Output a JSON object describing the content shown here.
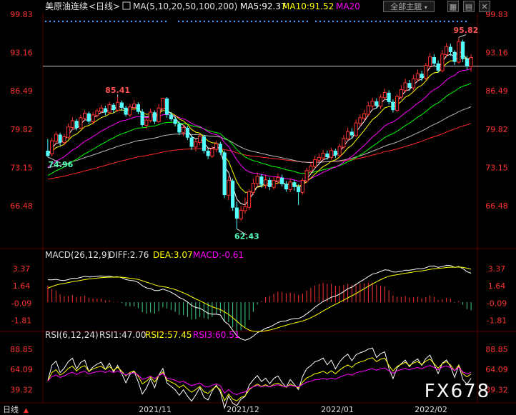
{
  "colors": {
    "up": "#ff3232",
    "down": "#54ffff",
    "ma5": "#ffffff",
    "ma10": "#ffff00",
    "ma20": "#ff00ff",
    "ma50": "#00ff00",
    "ma100": "#bbbbbb",
    "ma200": "#ff2a2a",
    "axis": "#ff3232",
    "grid": "#5a0000",
    "high_label": "#ff5050",
    "low_label": "#54ffbb"
  },
  "header": {
    "instrument": "美原油连续",
    "period": "<日线>",
    "ma_set": "MA(5,10,20,50,100,200)",
    "ma5": "MA5:92.37",
    "ma10": "MA10:91.52",
    "ma20": "MA20",
    "dropdown_value": "全部主题",
    "icon_names": [
      "chart-icon",
      "grid-icon",
      "close-icon"
    ]
  },
  "price_panel": {
    "y_ticks": [
      "99.83",
      "93.16",
      "86.49",
      "79.82",
      "73.15",
      "66.48"
    ],
    "annotations": {
      "high_1": "85.41",
      "low_1": "74.96",
      "low_2": "62.43",
      "high_2": "95.82"
    }
  },
  "macd_panel": {
    "title": "MACD(26,12,9)",
    "diff": "DIFF:2.76",
    "dea": "DEA:3.07",
    "macd": "MACD:-0.61",
    "y_ticks": [
      "3.37",
      "1.64",
      "-0.09",
      "-1.81"
    ]
  },
  "rsi_panel": {
    "title": "RSI(6,12,24)",
    "rsi1": "RSI1:47.00",
    "rsi2": "RSI2:57.45",
    "rsi3": "RSI3:60.51",
    "y_ticks": [
      "88.85",
      "64.09",
      "39.32"
    ]
  },
  "bottom": {
    "period_tab": "日线",
    "dates": [
      "2021/11",
      "2021/12",
      "2022/01",
      "2022/02"
    ]
  },
  "watermark": "FX678",
  "chart_data": {
    "type": "candlestick",
    "ylim": [
      62.0,
      99.83
    ],
    "candles": [
      [
        76,
        75.2,
        78.1,
        74.96
      ],
      [
        75.5,
        77.8,
        78.3,
        75.1
      ],
      [
        77.7,
        78.9,
        79.4,
        77.2
      ],
      [
        78.8,
        77.6,
        79.2,
        76.9
      ],
      [
        77.5,
        78.5,
        79.0,
        77.0
      ],
      [
        78.4,
        80.2,
        80.8,
        78.1
      ],
      [
        80.1,
        81.3,
        81.9,
        79.7
      ],
      [
        81.2,
        80.1,
        81.6,
        79.6
      ],
      [
        80.0,
        81.8,
        82.3,
        79.8
      ],
      [
        81.7,
        82.6,
        83.1,
        81.3
      ],
      [
        82.5,
        81.2,
        82.9,
        80.7
      ],
      [
        81.1,
        82.3,
        82.8,
        80.6
      ],
      [
        82.2,
        83.0,
        83.4,
        81.8
      ],
      [
        82.9,
        83.5,
        84.1,
        82.5
      ],
      [
        83.4,
        82.8,
        83.9,
        82.2
      ],
      [
        82.7,
        84.1,
        84.6,
        82.4
      ],
      [
        84.0,
        83.2,
        84.4,
        82.6
      ],
      [
        83.1,
        84.5,
        85.41,
        82.9
      ],
      [
        84.4,
        83.6,
        84.8,
        83.0
      ],
      [
        83.5,
        82.4,
        83.9,
        82.0
      ],
      [
        82.3,
        83.7,
        84.2,
        81.9
      ],
      [
        83.6,
        84.2,
        84.9,
        83.1
      ],
      [
        84.1,
        82.9,
        84.5,
        82.4
      ],
      [
        82.8,
        80.6,
        83.3,
        80.2
      ],
      [
        80.5,
        81.4,
        81.9,
        79.9
      ],
      [
        81.3,
        82.8,
        83.4,
        81.0
      ],
      [
        82.7,
        81.2,
        83.1,
        80.7
      ],
      [
        81.1,
        83.5,
        84.2,
        80.9
      ],
      [
        83.4,
        85.2,
        85.3,
        83.0
      ],
      [
        85.1,
        82.4,
        85.4,
        81.8
      ],
      [
        82.3,
        81.6,
        82.8,
        81.2
      ],
      [
        81.5,
        80.8,
        82.0,
        80.3
      ],
      [
        80.7,
        79.3,
        81.2,
        78.8
      ],
      [
        79.2,
        80.1,
        80.6,
        78.6
      ],
      [
        80.0,
        78.4,
        80.4,
        77.9
      ],
      [
        78.3,
        76.8,
        78.8,
        76.2
      ],
      [
        76.7,
        77.6,
        78.1,
        75.9
      ],
      [
        77.5,
        78.6,
        79.1,
        77.0
      ],
      [
        78.5,
        76.1,
        78.8,
        75.6
      ],
      [
        76.0,
        75.2,
        76.5,
        74.6
      ],
      [
        75.1,
        76.4,
        76.9,
        74.8
      ],
      [
        76.3,
        77.3,
        77.8,
        75.8
      ],
      [
        77.2,
        75.8,
        77.6,
        75.3
      ],
      [
        75.7,
        68.4,
        76.1,
        67.8
      ],
      [
        68.3,
        70.9,
        71.6,
        67.4
      ],
      [
        70.8,
        66.2,
        71.2,
        65.6
      ],
      [
        66.1,
        64.3,
        67.2,
        62.43
      ],
      [
        64.2,
        65.7,
        66.4,
        63.8
      ],
      [
        65.6,
        66.3,
        67.9,
        65.1
      ],
      [
        66.2,
        68.9,
        69.3,
        65.8
      ],
      [
        68.8,
        70.4,
        71.2,
        68.3
      ],
      [
        70.3,
        71.6,
        72.3,
        69.8
      ],
      [
        71.5,
        70.2,
        72.0,
        69.6
      ],
      [
        70.1,
        71.0,
        71.8,
        69.5
      ],
      [
        70.9,
        69.8,
        71.4,
        69.2
      ],
      [
        69.7,
        70.9,
        71.5,
        69.3
      ],
      [
        70.8,
        71.4,
        72.1,
        70.2
      ],
      [
        71.3,
        70.3,
        71.9,
        69.8
      ],
      [
        70.2,
        69.4,
        70.8,
        68.9
      ],
      [
        69.3,
        70.6,
        71.2,
        68.8
      ],
      [
        70.5,
        69.8,
        71.0,
        69.1
      ],
      [
        69.7,
        68.9,
        70.2,
        66.6
      ],
      [
        68.8,
        70.9,
        71.3,
        68.4
      ],
      [
        70.8,
        72.6,
        73.1,
        70.4
      ],
      [
        72.5,
        73.4,
        74.0,
        72.0
      ],
      [
        73.3,
        74.5,
        75.2,
        73.0
      ],
      [
        74.4,
        74.9,
        75.6,
        74.0
      ],
      [
        74.8,
        75.6,
        76.2,
        74.3
      ],
      [
        75.5,
        75.0,
        76.1,
        74.5
      ],
      [
        74.9,
        76.1,
        76.6,
        74.5
      ],
      [
        76.0,
        75.3,
        76.4,
        74.8
      ],
      [
        75.2,
        76.8,
        77.3,
        74.9
      ],
      [
        76.7,
        78.2,
        78.8,
        76.4
      ],
      [
        78.1,
        79.4,
        80.1,
        77.8
      ],
      [
        79.3,
        78.8,
        80.0,
        78.2
      ],
      [
        78.7,
        80.9,
        81.5,
        78.4
      ],
      [
        80.8,
        81.8,
        82.4,
        80.3
      ],
      [
        81.7,
        82.5,
        83.2,
        81.2
      ],
      [
        82.4,
        83.9,
        84.6,
        82.0
      ],
      [
        83.8,
        84.7,
        85.3,
        83.2
      ],
      [
        84.6,
        83.9,
        85.2,
        83.4
      ],
      [
        83.8,
        85.4,
        85.9,
        83.3
      ],
      [
        85.3,
        86.2,
        86.9,
        84.9
      ],
      [
        86.1,
        84.6,
        86.6,
        84.1
      ],
      [
        84.5,
        83.2,
        85.0,
        82.7
      ],
      [
        83.1,
        85.5,
        85.9,
        82.8
      ],
      [
        85.4,
        86.7,
        87.5,
        85.0
      ],
      [
        86.6,
        87.9,
        88.6,
        86.2
      ],
      [
        87.8,
        87.1,
        88.4,
        86.5
      ],
      [
        87.0,
        88.6,
        89.3,
        86.6
      ],
      [
        88.5,
        89.5,
        90.2,
        88.0
      ],
      [
        89.4,
        88.8,
        90.0,
        88.2
      ],
      [
        88.7,
        90.9,
        91.4,
        88.4
      ],
      [
        90.8,
        92.4,
        93.1,
        90.3
      ],
      [
        92.3,
        91.3,
        92.9,
        90.8
      ],
      [
        91.2,
        90.1,
        91.8,
        89.6
      ],
      [
        90.0,
        92.9,
        93.6,
        89.7
      ],
      [
        92.8,
        94.2,
        94.8,
        92.3
      ],
      [
        94.1,
        93.3,
        94.7,
        92.6
      ],
      [
        93.2,
        91.6,
        93.6,
        91.0
      ],
      [
        91.5,
        95.1,
        95.82,
        91.2
      ],
      [
        95.0,
        92.1,
        95.4,
        91.5
      ],
      [
        92.0,
        90.8,
        92.6,
        90.2
      ],
      [
        90.7,
        92.3,
        92.9,
        89.8
      ]
    ],
    "macd": {
      "diff_last": 2.76,
      "dea_last": 3.07,
      "macd_last": -0.61,
      "ylim": [
        -2.5,
        3.8
      ]
    },
    "rsi": {
      "rsi1_last": 47.0,
      "rsi2_last": 57.45,
      "rsi3_last": 60.51,
      "ylim": [
        25,
        100
      ]
    }
  }
}
